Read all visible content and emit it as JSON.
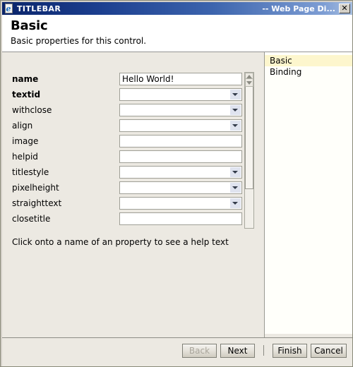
{
  "titlebar": {
    "icon": "ie-page-icon",
    "title": "TITLEBAR",
    "right_text": "-- Web Page Di...",
    "close_label": "✕"
  },
  "header": {
    "title": "Basic",
    "subtitle": "Basic properties for this control."
  },
  "form": {
    "rows": [
      {
        "label": "name",
        "required": true,
        "type": "text",
        "value": "Hello World!"
      },
      {
        "label": "textid",
        "required": true,
        "type": "combo",
        "value": ""
      },
      {
        "label": "withclose",
        "required": false,
        "type": "combo",
        "value": ""
      },
      {
        "label": "align",
        "required": false,
        "type": "combo",
        "value": ""
      },
      {
        "label": "image",
        "required": false,
        "type": "text",
        "value": ""
      },
      {
        "label": "helpid",
        "required": false,
        "type": "text",
        "value": ""
      },
      {
        "label": "titlestyle",
        "required": false,
        "type": "combo",
        "value": ""
      },
      {
        "label": "pixelheight",
        "required": false,
        "type": "combo",
        "value": ""
      },
      {
        "label": "straighttext",
        "required": false,
        "type": "combo",
        "value": ""
      },
      {
        "label": "closetitle",
        "required": false,
        "type": "text",
        "value": ""
      }
    ],
    "hint": "Click onto a name of an property to see a help text"
  },
  "sections": {
    "items": [
      {
        "label": "Basic",
        "selected": true
      },
      {
        "label": "Binding",
        "selected": false
      }
    ]
  },
  "buttons": {
    "back": {
      "label": "Back",
      "disabled": true
    },
    "next": {
      "label": "Next",
      "disabled": false
    },
    "finish": {
      "label": "Finish",
      "disabled": false
    },
    "cancel": {
      "label": "Cancel",
      "disabled": false
    }
  },
  "colors": {
    "title_gradient_start": "#0a246a",
    "title_gradient_end": "#a8bfe0",
    "dialog_bg": "#ece9e2",
    "selection": "#fdf6cd",
    "field_bg": "#ffffff"
  }
}
